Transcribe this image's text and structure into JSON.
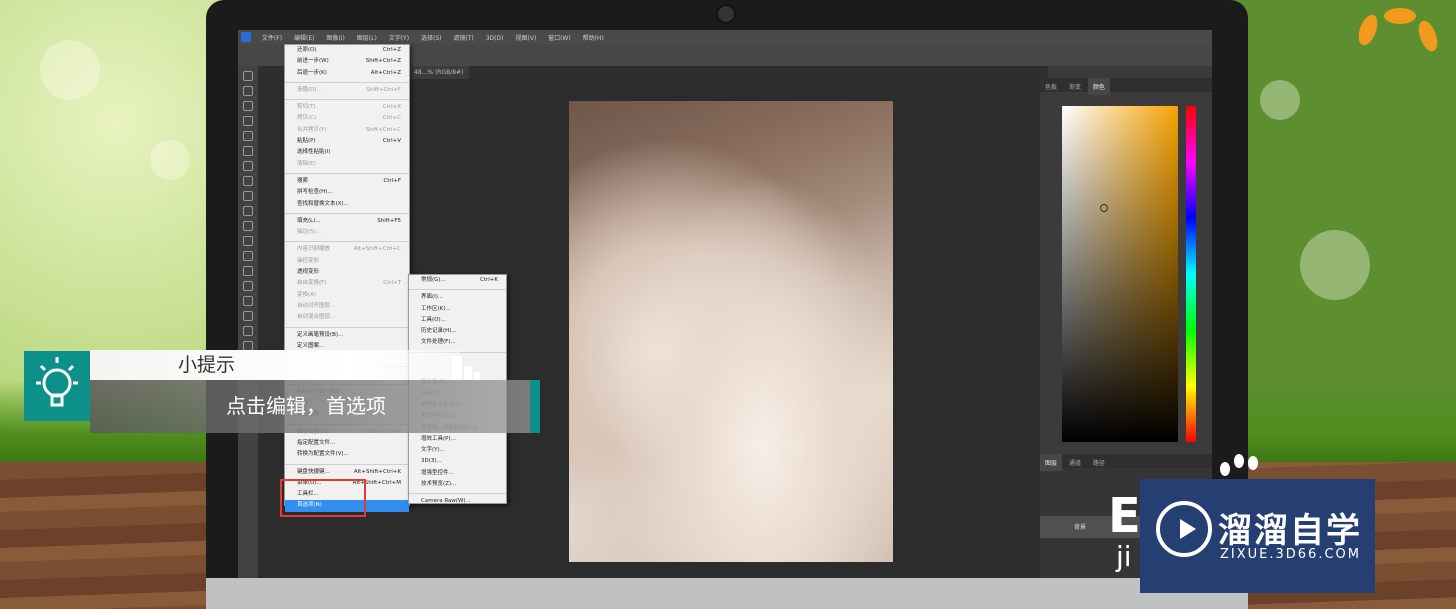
{
  "photoshop": {
    "menubar": [
      "文件(F)",
      "编辑(E)",
      "图像(I)",
      "图层(L)",
      "文字(Y)",
      "选择(S)",
      "滤镜(T)",
      "3D(D)",
      "视图(V)",
      "窗口(W)",
      "帮助(H)"
    ],
    "document_tab": "48...% (RGB/8#)",
    "panel_tabs": [
      "色板",
      "渐变",
      "颜色"
    ],
    "layers_tabs": [
      "图层",
      "通道",
      "路径"
    ],
    "layer_name": "背景"
  },
  "edit_menu": {
    "items": [
      {
        "label": "还原(O)",
        "shortcut": "Ctrl+Z",
        "state": "normal"
      },
      {
        "label": "前进一步(W)",
        "shortcut": "Shift+Ctrl+Z",
        "state": "normal"
      },
      {
        "label": "后退一步(K)",
        "shortcut": "Alt+Ctrl+Z",
        "state": "normal"
      },
      {
        "sep": true
      },
      {
        "label": "渐隐(D)...",
        "shortcut": "Shift+Ctrl+F",
        "state": "dis"
      },
      {
        "sep": true
      },
      {
        "label": "剪切(T)",
        "shortcut": "Ctrl+X",
        "state": "dis"
      },
      {
        "label": "拷贝(C)",
        "shortcut": "Ctrl+C",
        "state": "dis"
      },
      {
        "label": "合并拷贝(Y)",
        "shortcut": "Shift+Ctrl+C",
        "state": "dis"
      },
      {
        "label": "粘贴(P)",
        "shortcut": "Ctrl+V",
        "state": "normal"
      },
      {
        "label": "选择性粘贴(I)",
        "shortcut": "",
        "state": "normal"
      },
      {
        "label": "清除(E)",
        "shortcut": "",
        "state": "dis"
      },
      {
        "sep": true
      },
      {
        "label": "搜索",
        "shortcut": "Ctrl+F",
        "state": "normal"
      },
      {
        "label": "拼写检查(H)...",
        "shortcut": "",
        "state": "normal"
      },
      {
        "label": "查找和替换文本(X)...",
        "shortcut": "",
        "state": "normal"
      },
      {
        "sep": true
      },
      {
        "label": "填充(L)...",
        "shortcut": "Shift+F5",
        "state": "normal"
      },
      {
        "label": "描边(S)...",
        "shortcut": "",
        "state": "dis"
      },
      {
        "sep": true
      },
      {
        "label": "内容识别缩放",
        "shortcut": "Alt+Shift+Ctrl+C",
        "state": "dis"
      },
      {
        "label": "操控变形",
        "shortcut": "",
        "state": "dis"
      },
      {
        "label": "透视变形",
        "shortcut": "",
        "state": "normal"
      },
      {
        "label": "自由变换(F)",
        "shortcut": "Ctrl+T",
        "state": "dis"
      },
      {
        "label": "变换(A)",
        "shortcut": "",
        "state": "dis"
      },
      {
        "label": "自动对齐图层...",
        "shortcut": "",
        "state": "dis"
      },
      {
        "label": "自动混合图层...",
        "shortcut": "",
        "state": "dis"
      },
      {
        "sep": true
      },
      {
        "label": "定义画笔预设(B)...",
        "shortcut": "",
        "state": "normal"
      },
      {
        "label": "定义图案...",
        "shortcut": "",
        "state": "normal"
      },
      {
        "label": "定义自定形状...",
        "shortcut": "",
        "state": "dis"
      },
      {
        "sep": true
      },
      {
        "label": "清理(R)",
        "shortcut": "",
        "state": "normal"
      },
      {
        "sep": true
      },
      {
        "label": "Adobe PDF 预设...",
        "shortcut": "",
        "state": "dis"
      },
      {
        "label": "预设",
        "shortcut": "",
        "state": "dis"
      },
      {
        "label": "远程连接...",
        "shortcut": "",
        "state": "dis"
      },
      {
        "sep": true
      },
      {
        "label": "颜色设置(G)...",
        "shortcut": "Shift+Ctrl+K",
        "state": "dis"
      },
      {
        "label": "指定配置文件...",
        "shortcut": "",
        "state": "normal"
      },
      {
        "label": "转换为配置文件(V)...",
        "shortcut": "",
        "state": "normal"
      },
      {
        "sep": true
      },
      {
        "label": "键盘快捷键...",
        "shortcut": "Alt+Shift+Ctrl+K",
        "state": "normal"
      },
      {
        "label": "菜单(U)...",
        "shortcut": "Alt+Shift+Ctrl+M",
        "state": "normal"
      },
      {
        "label": "工具栏...",
        "shortcut": "",
        "state": "normal"
      },
      {
        "label": "首选项(N)",
        "shortcut": "",
        "state": "sel"
      }
    ]
  },
  "submenu": {
    "items": [
      {
        "label": "常规(G)...",
        "shortcut": "Ctrl+K",
        "state": "normal"
      },
      {
        "sep": true
      },
      {
        "label": "界面(I)...",
        "shortcut": "",
        "state": "normal"
      },
      {
        "label": "工作区(K)...",
        "shortcut": "",
        "state": "normal"
      },
      {
        "label": "工具(O)...",
        "shortcut": "",
        "state": "normal"
      },
      {
        "label": "历史记录(H)...",
        "shortcut": "",
        "state": "normal"
      },
      {
        "label": "文件处理(F)...",
        "shortcut": "",
        "state": "normal"
      },
      {
        "sep": true
      },
      {
        "label": "",
        "shortcut": "",
        "state": "dis"
      },
      {
        "label": "",
        "shortcut": "",
        "state": "dis"
      },
      {
        "label": "暂存盘(S)...",
        "shortcut": "",
        "state": "dis"
      },
      {
        "label": "光标(C)...",
        "shortcut": "",
        "state": "dis"
      },
      {
        "label": "透明度与色域(T)...",
        "shortcut": "",
        "state": "dis"
      },
      {
        "label": "单位与标尺(U)...",
        "shortcut": "",
        "state": "dis"
      },
      {
        "label": "参考线、网格和切片(S)...",
        "shortcut": "",
        "state": "dis"
      },
      {
        "label": "增效工具(P)...",
        "shortcut": "",
        "state": "normal"
      },
      {
        "label": "文字(Y)...",
        "shortcut": "",
        "state": "normal"
      },
      {
        "label": "3D(3)...",
        "shortcut": "",
        "state": "normal"
      },
      {
        "label": "增强型控件...",
        "shortcut": "",
        "state": "normal"
      },
      {
        "label": "技术预览(Z)...",
        "shortcut": "",
        "state": "normal"
      },
      {
        "sep": true
      },
      {
        "label": "Camera Raw(W)...",
        "shortcut": "",
        "state": "normal"
      }
    ]
  },
  "tip": {
    "title": "小提示",
    "body": "点击编辑，首选项"
  },
  "watermark": {
    "title": "溜溜自学",
    "subtitle": "ZIXUE.3D66.COM"
  },
  "screen_overlay": {
    "letters": "E",
    "ji": "ji"
  },
  "colors": {
    "accent": "#0d8f8a",
    "highlight": "#2f8ef0",
    "redbox": "#e53935",
    "watermark_bg": "#263f73"
  }
}
